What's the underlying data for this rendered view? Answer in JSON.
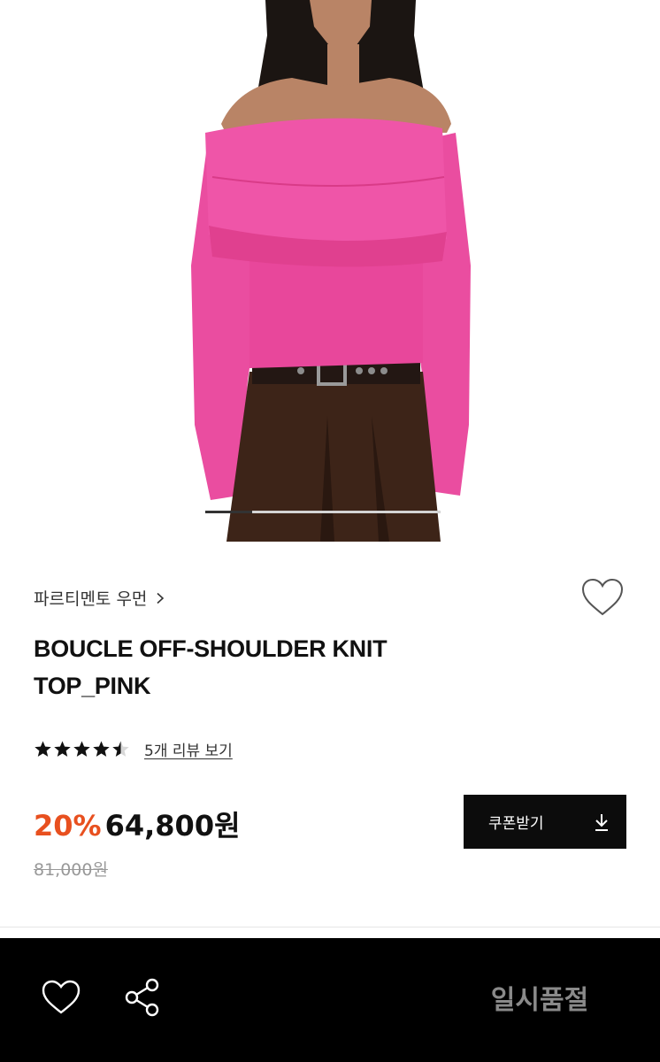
{
  "gallery": {
    "image_label": "product-photo",
    "current_index": 1,
    "total_images": 5,
    "progress_fraction": 0.2,
    "colors": {
      "knit": "#ee4aa0",
      "skirt": "#3d2418",
      "belt": "#231713",
      "skin": "#b98466",
      "hair": "#1b1512"
    }
  },
  "product": {
    "brand": "파르티멘토 우먼",
    "title": "BOUCLE OFF-SHOULDER KNIT TOP_PINK",
    "rating": 4.5,
    "review_link": "5개 리뷰 보기",
    "discount": "20%",
    "price": "64,800원",
    "original_price": "81,000원",
    "coupon_label": "쿠폰받기"
  },
  "bottom_bar": {
    "status_label": "일시품절"
  },
  "icons": {
    "brand_chevron": "chevron-right-icon",
    "wishlist": "heart-icon",
    "share": "share-icon",
    "download": "download-icon",
    "star": "star-icon"
  },
  "colors": {
    "accent_discount": "#e8501f",
    "button_bg": "#0c0c0c",
    "bottom_bar_bg": "#000000",
    "soldout_text": "#8a8a8a"
  }
}
